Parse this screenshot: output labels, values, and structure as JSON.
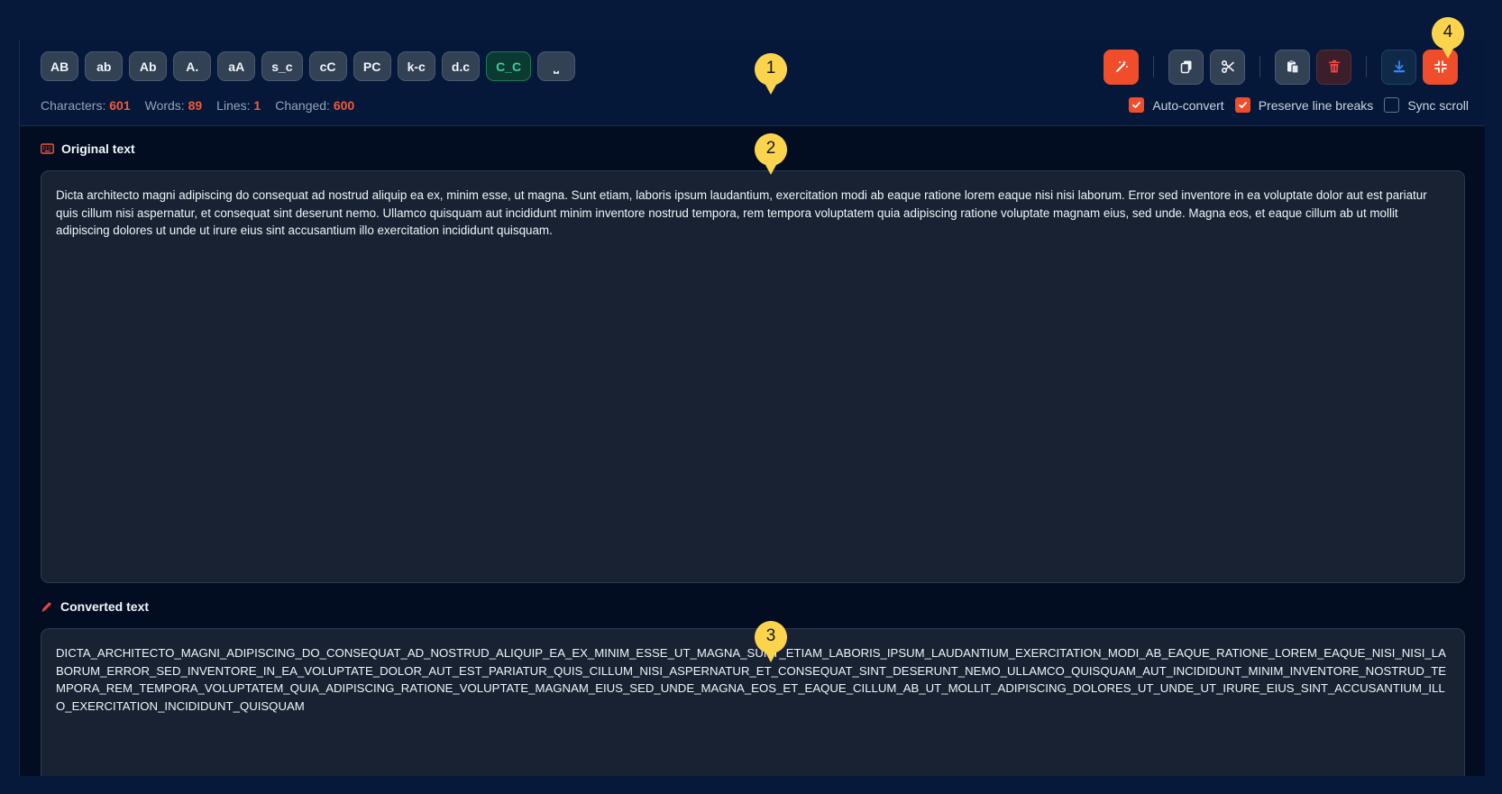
{
  "case_buttons": [
    "AB",
    "ab",
    "Ab",
    "A.",
    "aA",
    "s_c",
    "cC",
    "PC",
    "k-c",
    "d.c",
    "C_C",
    "⎵"
  ],
  "active_case": "C_C",
  "stats": {
    "characters_label": "Characters:",
    "characters": "601",
    "words_label": "Words:",
    "words": "89",
    "lines_label": "Lines:",
    "lines": "1",
    "changed_label": "Changed:",
    "changed": "600"
  },
  "toolbar": {
    "icons": [
      "magic-wand-icon",
      "copy-icon",
      "cut-icon",
      "paste-icon",
      "trash-icon",
      "download-icon",
      "collapse-icon"
    ]
  },
  "options": {
    "auto_convert": {
      "label": "Auto-convert",
      "checked": true
    },
    "preserve_line_breaks": {
      "label": "Preserve line breaks",
      "checked": true
    },
    "sync_scroll": {
      "label": "Sync scroll",
      "checked": false
    }
  },
  "original": {
    "label": "Original text",
    "text": "Dicta architecto magni adipiscing do consequat ad nostrud aliquip ea ex, minim esse, ut magna. Sunt etiam, laboris ipsum laudantium, exercitation modi ab eaque ratione lorem eaque nisi nisi laborum. Error sed inventore in ea voluptate dolor aut est pariatur quis cillum nisi aspernatur, et consequat sint deserunt nemo. Ullamco quisquam aut incididunt minim inventore nostrud tempora, rem tempora voluptatem quia adipiscing ratione voluptate magnam eius, sed unde. Magna eos, et eaque cillum ab ut mollit adipiscing dolores ut unde ut irure eius sint accusantium illo exercitation incididunt quisquam."
  },
  "converted": {
    "label": "Converted text",
    "text": "DICTA_ARCHITECTO_MAGNI_ADIPISCING_DO_CONSEQUAT_AD_NOSTRUD_ALIQUIP_EA_EX_MINIM_ESSE_UT_MAGNA_SUNT_ETIAM_LABORIS_IPSUM_LAUDANTIUM_EXERCITATION_MODI_AB_EAQUE_RATIONE_LOREM_EAQUE_NISI_NISI_LABORUM_ERROR_SED_INVENTORE_IN_EA_VOLUPTATE_DOLOR_AUT_EST_PARIATUR_QUIS_CILLUM_NISI_ASPERNATUR_ET_CONSEQUAT_SINT_DESERUNT_NEMO_ULLAMCO_QUISQUAM_AUT_INCIDIDUNT_MINIM_INVENTORE_NOSTRUD_TEMPORA_REM_TEMPORA_VOLUPTATEM_QUIA_ADIPISCING_RATIONE_VOLUPTATE_MAGNAM_EIUS_SED_UNDE_MAGNA_EOS_ET_EAQUE_CILLUM_AB_UT_MOLLIT_ADIPISCING_DOLORES_UT_UNDE_UT_IRURE_EIUS_SINT_ACCUSANTIUM_ILLO_EXERCITATION_INCIDIDUNT_QUISQUAM"
  },
  "markers": [
    "1",
    "2",
    "3",
    "4"
  ],
  "colors": {
    "accent": "#f04d2a",
    "active": "#34d399",
    "marker": "#fcd34d"
  }
}
